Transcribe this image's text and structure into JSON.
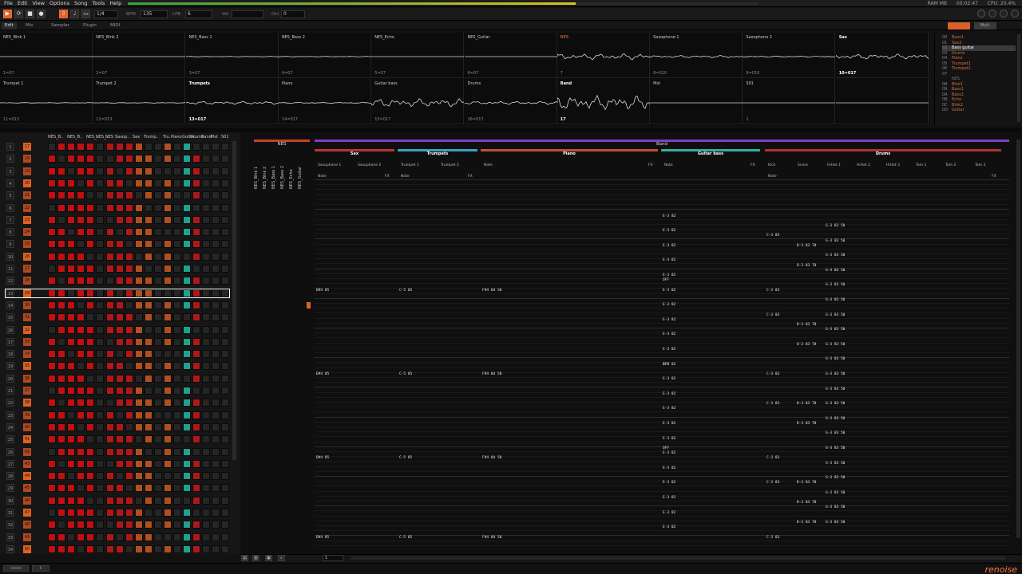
{
  "menu": [
    "File",
    "Edit",
    "View",
    "Options",
    "Song",
    "Tools",
    "Help"
  ],
  "status": {
    "ram": "RAM MB",
    "time": "00:02:47",
    "cpu": "CPU: 20.4%"
  },
  "playback_progress": 0.71,
  "toolbar": {
    "page": "1/4",
    "bpm_label": "BPM",
    "bpm": "135",
    "lpb_label": "LPB",
    "lpb": "6",
    "vel_label": "Vel",
    "oct_label": "Oct",
    "oct": "0"
  },
  "tabs": [
    "Edit",
    "Mix",
    "Sampler",
    "Plugin",
    "MIDI"
  ],
  "tab_right": "Mult.",
  "scopes": [
    {
      "name": "NES_Blnk 1",
      "foot": "1=07"
    },
    {
      "name": "NES_Blnk 2",
      "foot": "2=07"
    },
    {
      "name": "NES_Bass 1",
      "foot": "3=07"
    },
    {
      "name": "NES_Bass 2",
      "foot": "4=07"
    },
    {
      "name": "NES_Echo",
      "foot": "5=07"
    },
    {
      "name": "NES_Guitar",
      "foot": "6=07"
    },
    {
      "name": "NES",
      "foot": "7",
      "hi": true
    },
    {
      "name": "Saxophone 1",
      "foot": "8=010"
    },
    {
      "name": "Saxophone 2",
      "foot": "9=010"
    },
    {
      "name": "Sax",
      "foot": "10=017",
      "bold": true
    },
    {
      "name": "Trumpet 1",
      "foot": "11=013"
    },
    {
      "name": "Trumpet 2",
      "foot": "12=013"
    },
    {
      "name": "Trumpets",
      "foot": "13=017",
      "bold": true
    },
    {
      "name": "Piano",
      "foot": "14=017"
    },
    {
      "name": "Guitar bass",
      "foot": "15=017"
    },
    {
      "name": "Drums",
      "foot": "16=017"
    },
    {
      "name": "Band",
      "foot": "17",
      "bold": true
    },
    {
      "name": "Mst",
      "foot": ""
    },
    {
      "name": "S01",
      "foot": "1"
    },
    {
      "name": "",
      "foot": ""
    }
  ],
  "instruments": [
    {
      "num": "00",
      "name": "Bass1"
    },
    {
      "num": "01",
      "name": "Sax2"
    },
    {
      "num": "02",
      "name": "Bass guitar",
      "sel": true
    },
    {
      "num": "03",
      "name": "Drums"
    },
    {
      "num": "04",
      "name": "Piano"
    },
    {
      "num": "05",
      "name": "Trumpet1"
    },
    {
      "num": "06",
      "name": "Trumpet2"
    },
    {
      "num": "07",
      "name": "",
      "grey": true
    },
    {
      "num": "",
      "name": "NES",
      "grey": true
    },
    {
      "num": "08",
      "name": "Blnk1"
    },
    {
      "num": "09",
      "name": "Bass1"
    },
    {
      "num": "0A",
      "name": "Bass2"
    },
    {
      "num": "0B",
      "name": "Echo"
    },
    {
      "num": "0C",
      "name": "Blnk2"
    },
    {
      "num": "0D",
      "name": "Guitar"
    }
  ],
  "matrix": {
    "headers": [
      "NES_B..",
      "NES_B..",
      "NES_..",
      "NES_..",
      "NES",
      "Saxop..",
      "Sax",
      "Trump..",
      "Tru..",
      "Piano",
      "Guitar..",
      "Drums",
      "Band",
      "Mst",
      "S01"
    ],
    "rows": [
      "17",
      "18",
      "19",
      "20",
      "21",
      "22",
      "23",
      "24",
      "25",
      "26",
      "27",
      "28",
      "29",
      "30",
      "31",
      "32",
      "33",
      "34",
      "35",
      "36",
      "37",
      "38",
      "39",
      "40",
      "41",
      "42",
      "43",
      "44",
      "45",
      "46",
      "47",
      "48",
      "49",
      "50"
    ],
    "active_row": "29"
  },
  "pattern": {
    "groups": [
      {
        "name": "NES",
        "color": "#c8402a"
      },
      {
        "name": "Band",
        "color": "#8040c0"
      }
    ],
    "vertical_tracks": [
      "NES_Blnk 1",
      "NES_Blnk 2",
      "NES_Bass 1",
      "NES_Bass 2",
      "NES_Echo",
      "NES_Guitar"
    ],
    "tracks": [
      {
        "name": "Sax",
        "color": "#c03030",
        "subs": [
          "Saxophone 1",
          "Saxophone 2"
        ]
      },
      {
        "name": "Trumpets",
        "color": "#3aa0c8",
        "subs": [
          "Trumpet 1",
          "Trumpet 2"
        ]
      },
      {
        "name": "Piano",
        "color": "#c05030"
      },
      {
        "name": "Guitar bass",
        "color": "#30b0a0"
      },
      {
        "name": "Drums",
        "color": "#b03030",
        "subs": [
          "Kick",
          "Snare",
          "HiHat 1",
          "HiHat 2",
          "HiHat 3",
          "Tom 1",
          "Tom 2",
          "Tom 3"
        ]
      }
    ],
    "col_note": "Note",
    "col_fx": "FX",
    "events": [
      {
        "col": "sax",
        "text": "D#4 85"
      },
      {
        "col": "tr",
        "text": "C-5 85"
      },
      {
        "col": "pn",
        "text": "F#4 84 50"
      },
      {
        "col": "gb",
        "text": "E-3 82"
      },
      {
        "col": "kick",
        "text": "C-3 83"
      },
      {
        "col": "hh",
        "text": "G-3 83 50"
      },
      {
        "col": "sn",
        "text": "D-3 83 78"
      },
      {
        "col": "off",
        "text": "OFF"
      }
    ]
  },
  "bottom": {
    "page": "1"
  },
  "logo": "renoise"
}
